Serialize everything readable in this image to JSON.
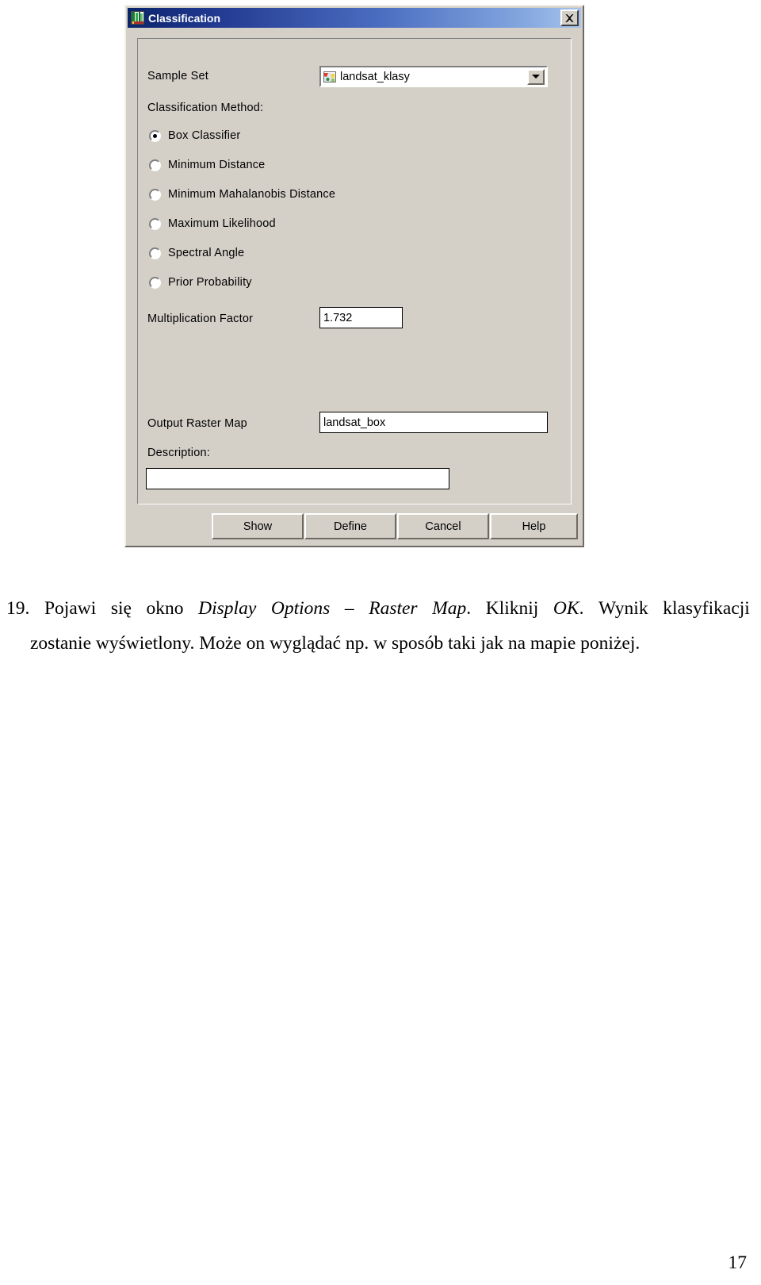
{
  "dialog": {
    "title": "Classification",
    "title_icon": "classification-app-icon",
    "close_label": "✕",
    "sample_set": {
      "label": "Sample Set",
      "value": "landsat_klasy",
      "icon": "sample-set-map-icon",
      "arrow_icon": "chevron-down-icon"
    },
    "method": {
      "label": "Classification Method:",
      "options": [
        {
          "label": "Box Classifier",
          "selected": true
        },
        {
          "label": "Minimum Distance",
          "selected": false
        },
        {
          "label": "Minimum Mahalanobis Distance",
          "selected": false
        },
        {
          "label": "Maximum Likelihood",
          "selected": false
        },
        {
          "label": "Spectral Angle",
          "selected": false
        },
        {
          "label": "Prior Probability",
          "selected": false
        }
      ]
    },
    "multiplication_factor": {
      "label": "Multiplication Factor",
      "value": "1.732"
    },
    "output_raster_map": {
      "label": "Output Raster Map",
      "value": "landsat_box"
    },
    "description": {
      "label": "Description:",
      "value": ""
    },
    "buttons": [
      {
        "label": "Show"
      },
      {
        "label": "Define"
      },
      {
        "label": "Cancel"
      },
      {
        "label": "Help"
      }
    ],
    "colors": {
      "face": "#d4d0c8",
      "title_start": "#0a246a",
      "title_end": "#a8c4ec",
      "text": "#000000"
    }
  },
  "document": {
    "step_number": "19.",
    "line1": {
      "w1": "Pojawi",
      "w2": "się",
      "w3": "okno",
      "w4": "Display",
      "w5": "Options",
      "w6": "–",
      "w7": "Raster",
      "w8": "Map",
      "w9": ".",
      "w10": "Kliknij",
      "w11": "OK",
      "w12": ".",
      "w13": "Wynik",
      "w14": "klasyfikacji"
    },
    "line2": "zostanie wyświetlony. Może on wyglądać np. w sposób taki jak na mapie poniżej.",
    "page_number": "17"
  }
}
